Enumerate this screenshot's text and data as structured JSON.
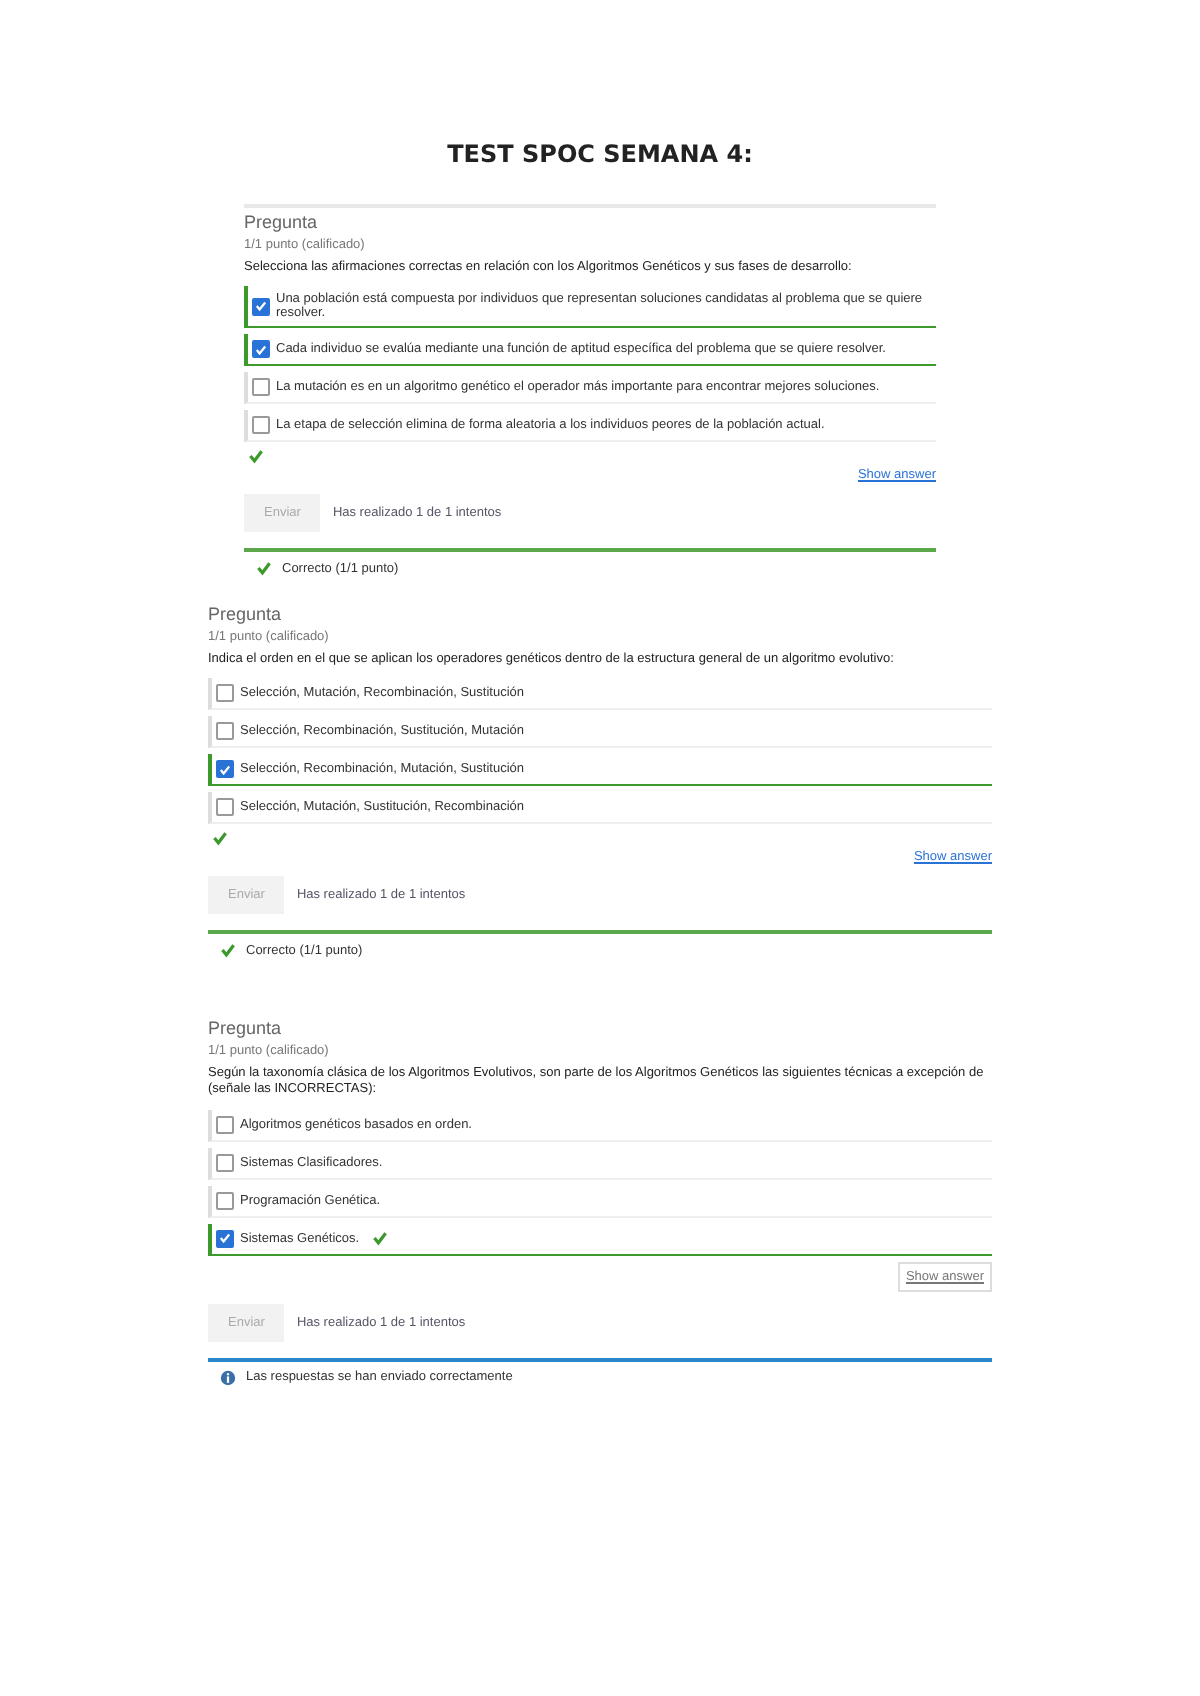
{
  "title": "TEST SPOC SEMANA 4:",
  "questions": [
    {
      "heading": "Pregunta",
      "points": "1/1 punto (calificado)",
      "prompt": "Selecciona las afirmaciones correctas en relación con los Algoritmos Genéticos y sus fases de desarrollo:",
      "inset": true,
      "options": [
        {
          "text": "Una población está compuesta por individuos que representan soluciones candidatas al problema que se quiere resolver.",
          "checked": true,
          "marked": false
        },
        {
          "text": "Cada individuo se evalúa mediante una función de aptitud específica del problema que se quiere resolver.",
          "checked": true,
          "marked": false
        },
        {
          "text": "La mutación es en un algoritmo genético el operador más importante para encontrar mejores soluciones.",
          "checked": false,
          "marked": false
        },
        {
          "text": "La etapa de selección elimina de forma aleatoria a los individuos peores de la población actual.",
          "checked": false,
          "marked": false
        }
      ],
      "result_mark": true,
      "answer": {
        "label": "Show answer",
        "kind": "link"
      },
      "submit": {
        "label": "Enviar",
        "disabled": true
      },
      "attempts": "Has realizado 1 de 1 intentos",
      "feedback": {
        "kind": "correct",
        "text": "Correcto (1/1 punto)"
      }
    },
    {
      "heading": "Pregunta",
      "points": "1/1 punto (calificado)",
      "prompt": "Indica el orden en el que se aplican los operadores genéticos dentro de la estructura general de un algoritmo evolutivo:",
      "inset": false,
      "options": [
        {
          "text": "Selección, Mutación, Recombinación, Sustitución",
          "checked": false,
          "marked": false
        },
        {
          "text": "Selección, Recombinación, Sustitución, Mutación",
          "checked": false,
          "marked": false
        },
        {
          "text": "Selección, Recombinación, Mutación, Sustitución",
          "checked": true,
          "marked": false
        },
        {
          "text": "Selección, Mutación, Sustitución, Recombinación",
          "checked": false,
          "marked": false
        }
      ],
      "result_mark": true,
      "answer": {
        "label": "Show answer",
        "kind": "link"
      },
      "submit": {
        "label": "Enviar",
        "disabled": true
      },
      "attempts": "Has realizado 1 de 1 intentos",
      "feedback": {
        "kind": "correct",
        "text": "Correcto (1/1 punto)"
      }
    },
    {
      "heading": "Pregunta",
      "points": "1/1 punto (calificado)",
      "prompt": "Según la taxonomía clásica de los Algoritmos Evolutivos, son parte de los Algoritmos Genéticos las siguientes técnicas a excepción de (señale las INCORRECTAS):",
      "inset": false,
      "options": [
        {
          "text": "Algoritmos genéticos basados en orden.",
          "checked": false,
          "marked": false
        },
        {
          "text": "Sistemas Clasificadores.",
          "checked": false,
          "marked": false
        },
        {
          "text": "Programación Genética.",
          "checked": false,
          "marked": false
        },
        {
          "text": "Sistemas Genéticos.",
          "checked": true,
          "marked": true
        }
      ],
      "result_mark": false,
      "answer": {
        "label": "Show answer",
        "kind": "button"
      },
      "submit": {
        "label": "Enviar",
        "disabled": true
      },
      "attempts": "Has realizado 1 de 1 intentos",
      "feedback": {
        "kind": "info",
        "text": "Las respuestas se han enviado correctamente"
      }
    }
  ]
}
